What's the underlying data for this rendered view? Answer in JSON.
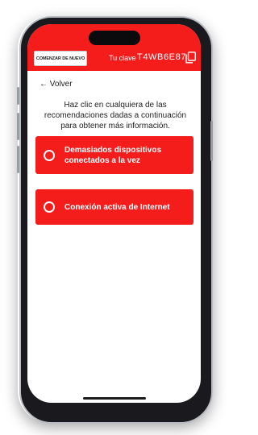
{
  "header": {
    "restart_label": "COMENZAR DE NUEVO",
    "key_label": "Tu clave",
    "key_value": "T4WB6E87",
    "copy_icon": "copy-icon",
    "background_color": "#f51c1c"
  },
  "back_label": "← Volver",
  "instructions": "Haz clic en cualquiera de las recomendaciones dadas a continuación para obtener más información.",
  "options": [
    {
      "label": "Demasiados dispositivos conectados a la vez",
      "icon": "radio-empty-icon"
    },
    {
      "label": "Conexión activa de Internet",
      "icon": "radio-empty-icon"
    }
  ],
  "accent_color": "#f51c1c"
}
